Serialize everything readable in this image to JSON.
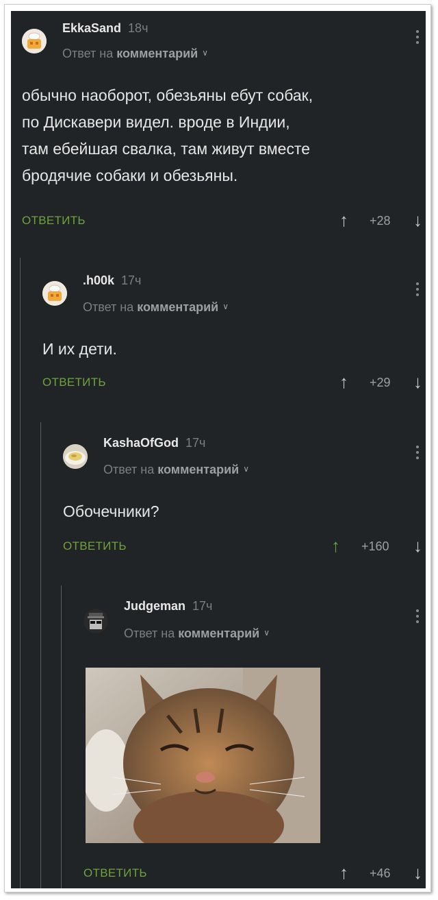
{
  "comments": [
    {
      "author": "EkkaSand",
      "time": "18ч",
      "reply_prefix": "Ответ на",
      "reply_link": "комментарий",
      "text_lines": [
        "обычно наоборот, обезьяны ебут собак,",
        "по Дискавери видел. вроде в Индии,",
        "там ебейшая свалка, там живут вместе",
        "бродячие собаки и обезьяны."
      ],
      "reply_label": "ОТВЕТИТЬ",
      "score": "+28"
    },
    {
      "author": ".h00k",
      "time": "17ч",
      "reply_prefix": "Ответ на",
      "reply_link": "комментарий",
      "text_lines": [
        "И их дети."
      ],
      "reply_label": "ОТВЕТИТЬ",
      "score": "+29"
    },
    {
      "author": "KashaOfGod",
      "time": "17ч",
      "reply_prefix": "Ответ на",
      "reply_link": "комментарий",
      "text_lines": [
        "Обочечники?"
      ],
      "reply_label": "ОТВЕТИТЬ",
      "score": "+160"
    },
    {
      "author": "Judgeman",
      "time": "17ч",
      "reply_prefix": "Ответ на",
      "reply_link": "комментарий",
      "reply_label": "ОТВЕТИТЬ",
      "score": "+46"
    }
  ],
  "icons": {
    "upvote": "arrow-up-icon",
    "downvote": "arrow-down-icon",
    "menu": "kebab-menu-icon",
    "chevron": "chevron-down-icon"
  },
  "colors": {
    "background": "#212426",
    "accent": "#6fa33b",
    "text": "#e6e6e6",
    "muted": "#7c7f82"
  }
}
